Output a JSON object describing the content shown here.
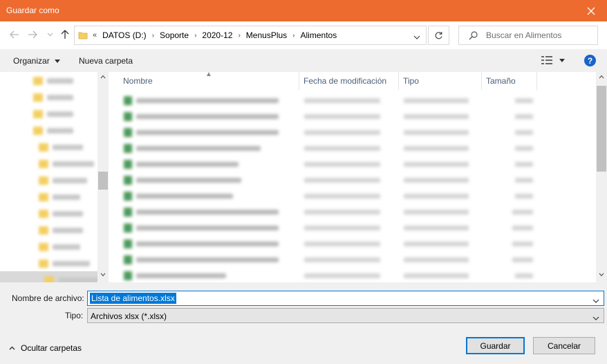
{
  "window": {
    "title": "Guardar como"
  },
  "nav": {
    "breadcrumbs": [
      "DATOS (D:)",
      "Soporte",
      "2020-12",
      "MenusPlus",
      "Alimentos"
    ],
    "search_placeholder": "Buscar en Alimentos"
  },
  "toolbar": {
    "organize": "Organizar",
    "new_folder": "Nueva carpeta",
    "help": "?"
  },
  "columns": {
    "name": "Nombre",
    "modified": "Fecha de modificación",
    "type": "Tipo",
    "size": "Tamaño"
  },
  "file_rows": [
    {
      "name": "",
      "modified": "",
      "type": "",
      "size": ""
    },
    {
      "name": "",
      "modified": "",
      "type": "",
      "size": ""
    },
    {
      "name": "",
      "modified": "",
      "type": "",
      "size": ""
    },
    {
      "name": "",
      "modified": "",
      "type": "",
      "size": ""
    },
    {
      "name": "",
      "modified": "",
      "type": "",
      "size": ""
    },
    {
      "name": "",
      "modified": "",
      "type": "",
      "size": ""
    },
    {
      "name": "",
      "modified": "",
      "type": "",
      "size": ""
    },
    {
      "name": "",
      "modified": "",
      "type": "",
      "size": ""
    },
    {
      "name": "",
      "modified": "",
      "type": "",
      "size": ""
    },
    {
      "name": "",
      "modified": "",
      "type": "",
      "size": ""
    },
    {
      "name": "",
      "modified": "",
      "type": "",
      "size": ""
    },
    {
      "name": "",
      "modified": "",
      "type": "",
      "size": ""
    },
    {
      "name": "",
      "modified": "",
      "type": "",
      "size": ""
    }
  ],
  "nav_tree": [
    {
      "label": ""
    },
    {
      "label": ""
    },
    {
      "label": ""
    },
    {
      "label": ""
    },
    {
      "label": ""
    },
    {
      "label": ""
    },
    {
      "label": ""
    },
    {
      "label": ""
    },
    {
      "label": ""
    },
    {
      "label": ""
    },
    {
      "label": ""
    },
    {
      "label": ""
    },
    {
      "label": ""
    }
  ],
  "bottom": {
    "filename_label": "Nombre de archivo:",
    "filename_value": "Lista de alimentos.xlsx",
    "type_label": "Tipo:",
    "type_value": "Archivos xlsx (*.xlsx)",
    "hide_folders": "Ocultar carpetas",
    "save": "Guardar",
    "cancel": "Cancelar"
  },
  "colors": {
    "titlebar": "#ed6b2f",
    "accent": "#0078d7",
    "excel_icon": "#4d9a5d",
    "folder": "#f3cf63"
  }
}
